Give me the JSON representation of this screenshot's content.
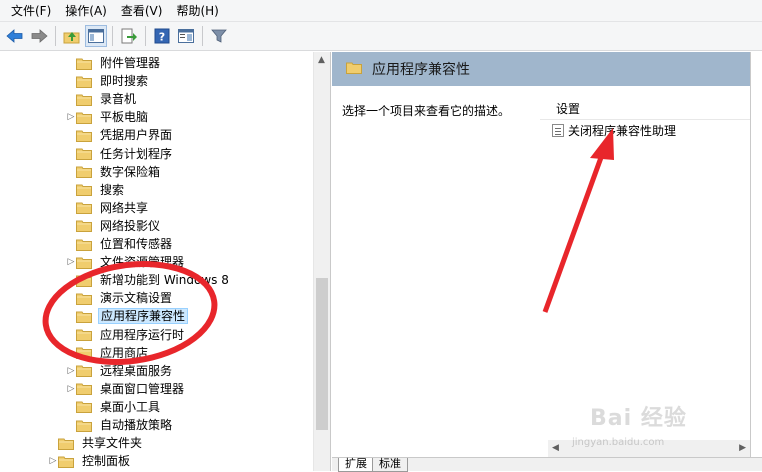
{
  "menu": [
    "文件(F)",
    "操作(A)",
    "查看(V)",
    "帮助(H)"
  ],
  "toolbar": {
    "icons": [
      "back-arrow-icon",
      "forward-arrow-icon",
      "up-folder-icon",
      "show-hide-tree-icon",
      "export-list-icon",
      "help-icon",
      "properties-view-icon",
      "filter-icon"
    ]
  },
  "tree": {
    "items": [
      {
        "label": "附件管理器",
        "expandable": false
      },
      {
        "label": "即时搜索",
        "expandable": false
      },
      {
        "label": "录音机",
        "expandable": false
      },
      {
        "label": "平板电脑",
        "expandable": true
      },
      {
        "label": "凭据用户界面",
        "expandable": false
      },
      {
        "label": "任务计划程序",
        "expandable": false
      },
      {
        "label": "数字保险箱",
        "expandable": false
      },
      {
        "label": "搜索",
        "expandable": false
      },
      {
        "label": "网络共享",
        "expandable": false
      },
      {
        "label": "网络投影仪",
        "expandable": false
      },
      {
        "label": "位置和传感器",
        "expandable": false
      },
      {
        "label": "文件资源管理器",
        "expandable": true
      },
      {
        "label": "新增功能到 Windows 8",
        "expandable": false
      },
      {
        "label": "演示文稿设置",
        "expandable": false
      },
      {
        "label": "应用程序兼容性",
        "expandable": false,
        "selected": true
      },
      {
        "label": "应用程序运行时",
        "expandable": false
      },
      {
        "label": "应用商店",
        "expandable": false
      },
      {
        "label": "远程桌面服务",
        "expandable": true
      },
      {
        "label": "桌面窗口管理器",
        "expandable": true
      },
      {
        "label": "桌面小工具",
        "expandable": false
      },
      {
        "label": "自动播放策略",
        "expandable": false
      }
    ],
    "root_items": [
      {
        "label": "共享文件夹",
        "expandable": false
      },
      {
        "label": "控制面板",
        "expandable": true
      }
    ]
  },
  "right": {
    "header_title": "应用程序兼容性",
    "description": "选择一个项目来查看它的描述。",
    "settings_column": "设置",
    "settings": [
      "关闭程序兼容性助理"
    ]
  },
  "tabs": [
    "扩展",
    "标准"
  ],
  "watermark": {
    "main": "Bai 经验",
    "sub": "jingyan.baidu.com"
  },
  "colors": {
    "header_band": "#a0b6cc",
    "selection": "#cce8ff",
    "annotation_red": "#e8262b",
    "folder": "#f0cd6e"
  }
}
